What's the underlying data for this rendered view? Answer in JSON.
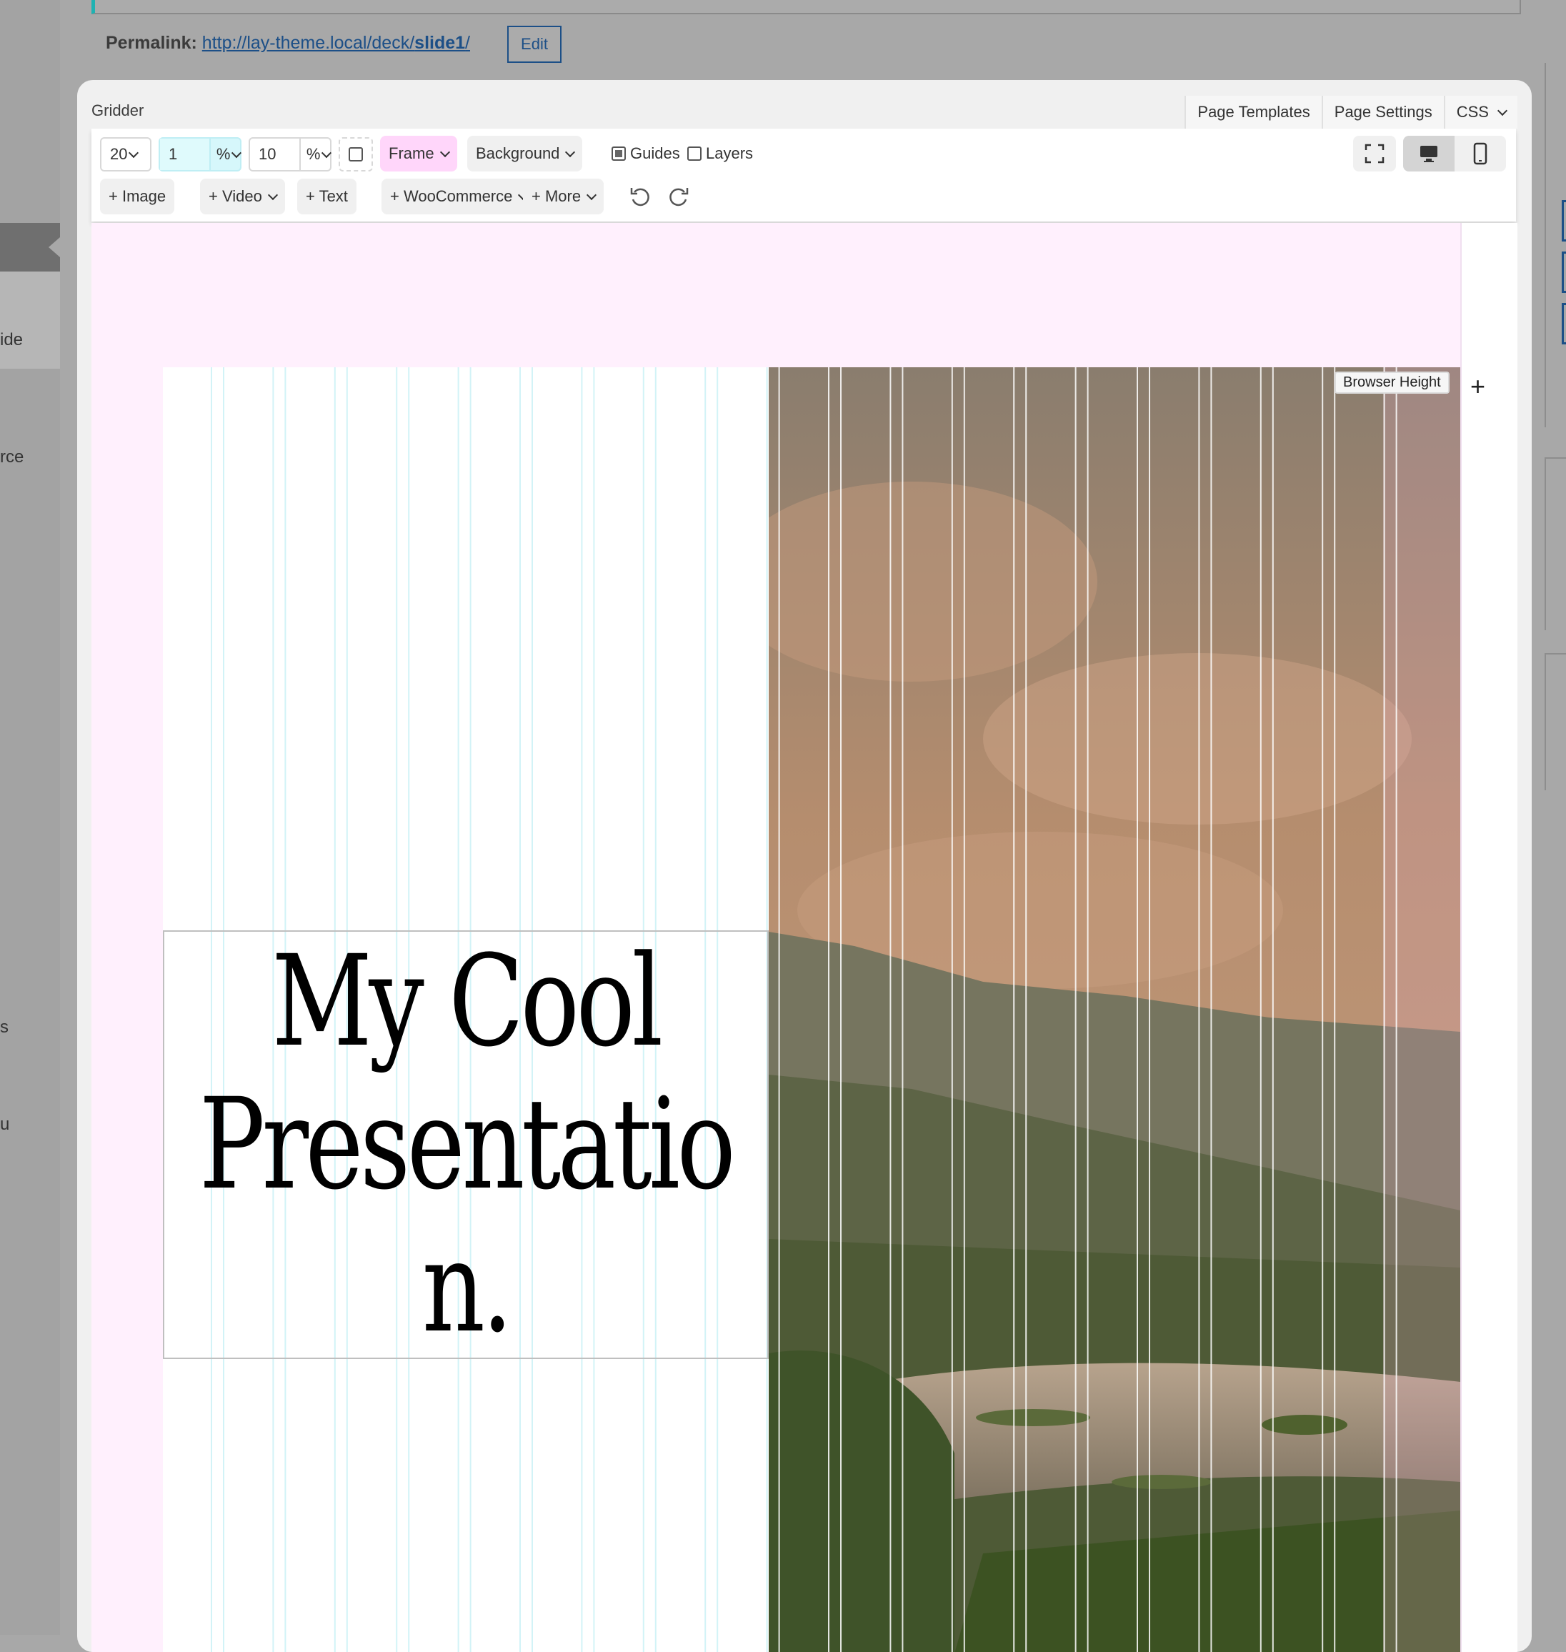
{
  "sidebar": {
    "fragments": [
      "ide",
      "rce",
      "s",
      "u"
    ]
  },
  "permalink": {
    "label": "Permalink:",
    "url_prefix": "http://lay-theme.local/deck/",
    "url_slug": "slide1",
    "url_suffix": "/",
    "edit_label": "Edit"
  },
  "modal": {
    "title": "Gridder",
    "tabs": [
      {
        "label": "Page Templates"
      },
      {
        "label": "Page Settings"
      },
      {
        "label": "CSS"
      }
    ]
  },
  "toolbar": {
    "columns": "20",
    "gap_value": "1",
    "gap_unit": "%",
    "frame_value": "10",
    "frame_unit": "%",
    "frame_label": "Frame",
    "background_label": "Background",
    "guides_label": "Guides",
    "guides_checked": true,
    "layers_label": "Layers",
    "layers_checked": false,
    "add_image": "+ Image",
    "add_video": "+ Video",
    "add_text": "+ Text",
    "add_woocommerce": "+ WooCommerce",
    "add_more": "+ More"
  },
  "canvas": {
    "title_lines": [
      "My Cool",
      "Presentatio",
      "n."
    ],
    "browser_height_label": "Browser Height",
    "add_row_label": "+"
  },
  "colors": {
    "accent_teal": "#1fb2b2",
    "link_blue": "#1c4f87",
    "frame_pink": "#ffd6fa",
    "gap_cyan": "#d6f7fb"
  }
}
